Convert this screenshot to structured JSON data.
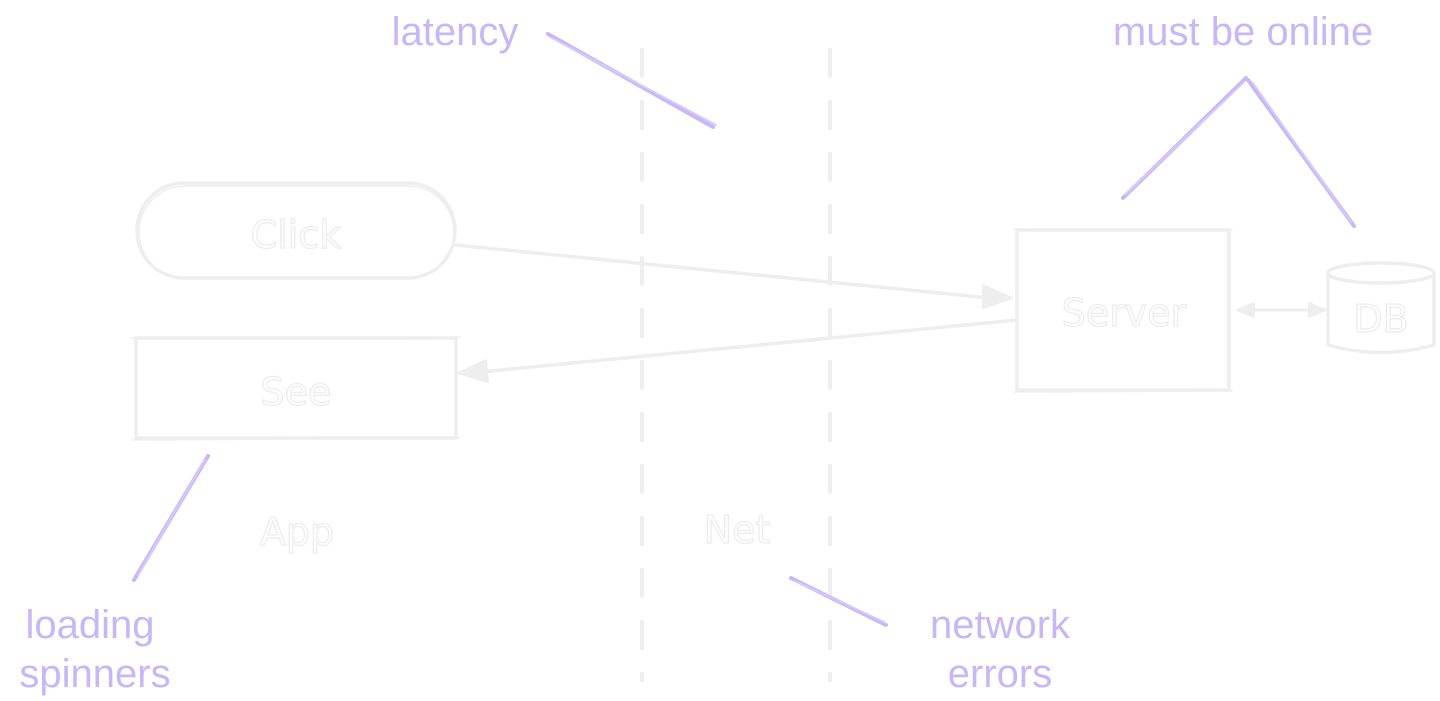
{
  "diagram": {
    "nodes": {
      "click": "Click",
      "see": "See",
      "server": "Server",
      "db": "DB"
    },
    "zones": {
      "app": "App",
      "net": "Net"
    },
    "annotations": {
      "latency": "latency",
      "must_be_online": "must be online",
      "loading_line1": "loading",
      "loading_line2": "spinners",
      "network_line1": "network",
      "network_line2": "errors"
    },
    "colors": {
      "annotation": "#c8b6f7",
      "sketch": "#eeeeee",
      "background": "#ffffff"
    }
  }
}
